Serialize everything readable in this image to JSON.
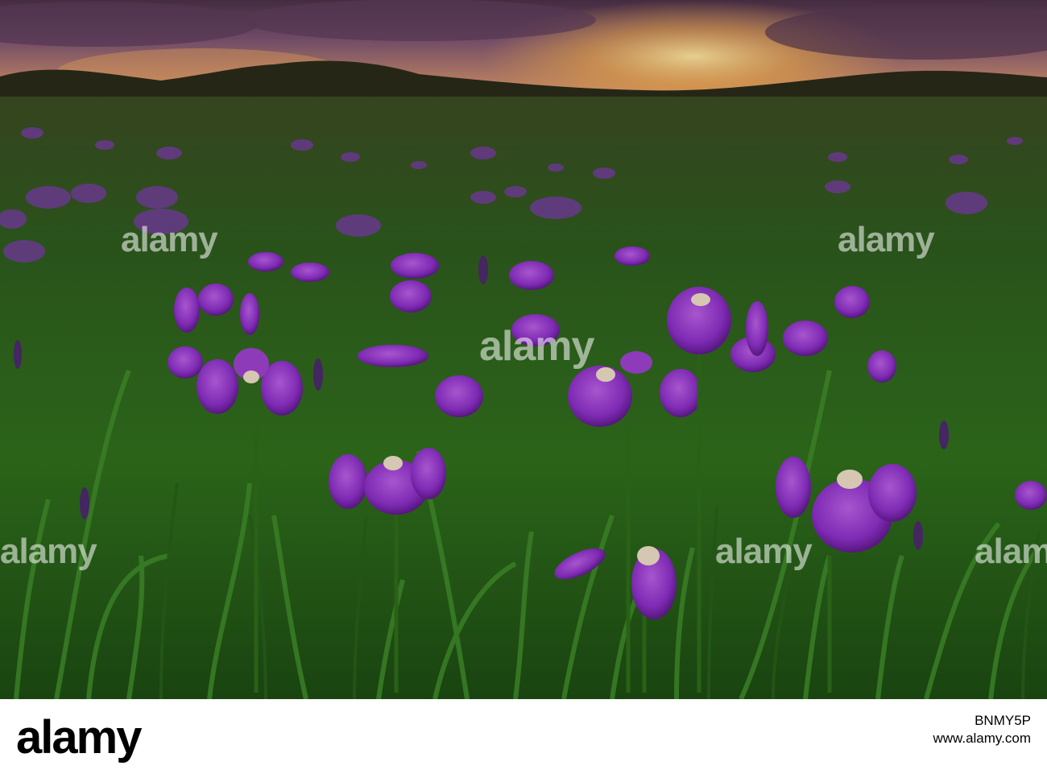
{
  "scene": {
    "subject": "field of purple wild iris flowers among tall green grass at sunset",
    "colors": {
      "sky_glow": "#f6b04a",
      "sky_purple": "#6e4a6e",
      "grass": "#2f6d1c",
      "flower": "#8a2fc4"
    }
  },
  "watermarks": {
    "text": "alamy"
  },
  "footer": {
    "logo": "alamy",
    "site": "www.alamy.com",
    "image_id": "BNMY5P"
  }
}
